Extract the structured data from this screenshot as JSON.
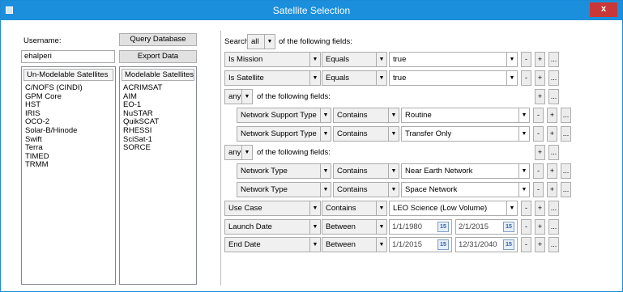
{
  "window": {
    "title": "Satellite Selection",
    "close_label": "x"
  },
  "left": {
    "username_label": "Username:",
    "username_value": "ehalperi",
    "query_button": "Query Database",
    "export_button": "Export Data",
    "unmodelable": {
      "header": "Un-Modelable Satellites",
      "items": [
        "C/NOFS (CINDI)",
        "GPM Core",
        "HST",
        "IRIS",
        "OCO-2",
        "Solar-B/Hinode",
        "Swift",
        "Terra",
        "TIMED",
        "TRMM"
      ]
    },
    "modelable": {
      "header": "Modelable Satellites",
      "items": [
        "ACRIMSAT",
        "AIM",
        "EO-1",
        "NuSTAR",
        "QuikSCAT",
        "RHESSI",
        "SciSat-1",
        "SORCE"
      ]
    }
  },
  "query": {
    "search_label": "Search",
    "search_scope": "all",
    "following_label": "of the following fields:",
    "rows": [
      {
        "field": "Is Mission",
        "op": "Equals",
        "value": "true"
      },
      {
        "field": "Is Satellite",
        "op": "Equals",
        "value": "true"
      }
    ],
    "group1": {
      "scope": "any",
      "label": "of the following fields:",
      "rows": [
        {
          "field": "Network Support Type",
          "op": "Contains",
          "value": "Routine"
        },
        {
          "field": "Network Support Type",
          "op": "Contains",
          "value": "Transfer Only"
        }
      ]
    },
    "group2": {
      "scope": "any",
      "label": "of the following fields:",
      "rows": [
        {
          "field": "Network Type",
          "op": "Contains",
          "value": "Near Earth Network"
        },
        {
          "field": "Network Type",
          "op": "Contains",
          "value": "Space Network"
        }
      ]
    },
    "use_case": {
      "field": "Use Case",
      "op": "Contains",
      "value": "LEO Science (Low Volume)"
    },
    "launch_date": {
      "field": "Launch Date",
      "op": "Between",
      "from": "1/1/1980",
      "to": "2/1/2015"
    },
    "end_date": {
      "field": "End Date",
      "op": "Between",
      "from": "1/1/2015",
      "to": "12/31/2040"
    },
    "calendar_icon_label": "15",
    "minus_label": "-",
    "plus_label": "+",
    "more_label": "..."
  }
}
